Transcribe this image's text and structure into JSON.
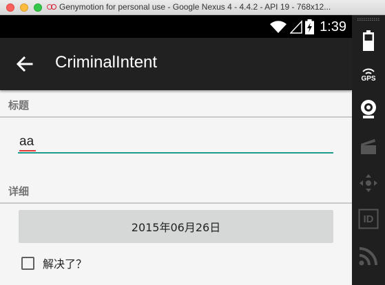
{
  "window": {
    "title": "Genymotion for personal use - Google Nexus 4 - 4.4.2 - API 19 - 768x12..."
  },
  "statusbar": {
    "time": "1:39",
    "icons": [
      "wifi-icon",
      "cell-signal-icon",
      "battery-charging-icon"
    ]
  },
  "actionbar": {
    "app_title": "CriminalIntent",
    "back_icon": "arrow-left-icon"
  },
  "form": {
    "title_section_label": "标题",
    "title_value": "aa",
    "details_section_label": "详细",
    "date_button_label": "2015年06月26日",
    "solved_checkbox_label": "解决了？",
    "solved_checked": false
  },
  "sidebar": {
    "gps_label": "GPS",
    "id_label": "ID",
    "tools": [
      "battery-icon",
      "gps-icon",
      "webcam-icon",
      "clapper-icon",
      "dpad-icon",
      "id-icon",
      "rss-icon"
    ]
  },
  "colors": {
    "accent": "#1a9c8c",
    "actionbar": "#212121",
    "statusbar": "#000000",
    "spellcheck": "#e53935"
  }
}
